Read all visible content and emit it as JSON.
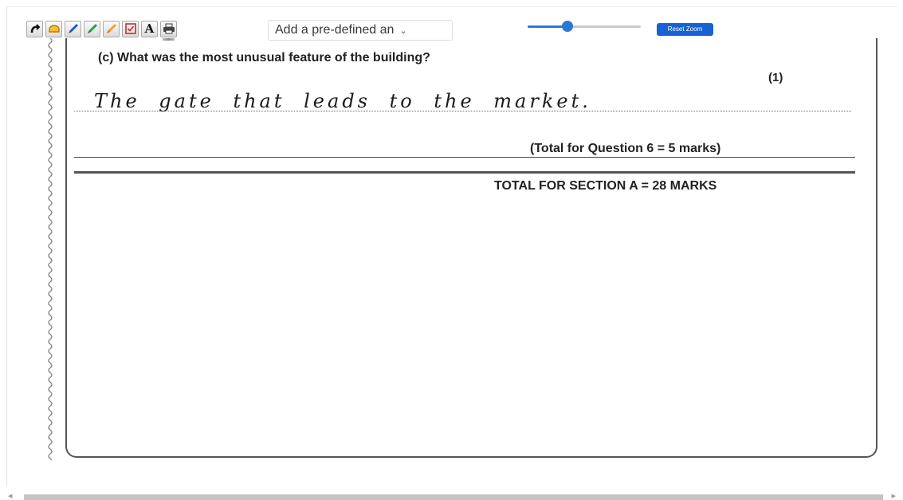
{
  "toolbar": {
    "tools": [
      {
        "name": "undo",
        "icon": "undo-arrow-icon"
      },
      {
        "name": "eraser",
        "icon": "eraser-icon"
      },
      {
        "name": "blue-pen",
        "icon": "blue-pen-icon",
        "color": "#1e57c9"
      },
      {
        "name": "green-pen",
        "icon": "green-pen-icon",
        "color": "#1aa33a"
      },
      {
        "name": "highlighter",
        "icon": "highlighter-icon",
        "color": "#f0a030"
      },
      {
        "name": "checkbox",
        "icon": "checkbox-tick-icon",
        "color": "#d02a2a"
      },
      {
        "name": "text",
        "icon": "text-tool-icon",
        "label": "A"
      },
      {
        "name": "print",
        "icon": "printer-icon"
      }
    ],
    "predefined_select": {
      "value": "Add a pre-defined an",
      "chevron": "chevron-down-icon"
    },
    "zoom_slider": {
      "value_percent": 35,
      "color": "#2e77d0"
    },
    "reset_zoom_label": "Reset Zoom",
    "reset_zoom_color": "#1662d2"
  },
  "document": {
    "question": "(c) What was the most unusual feature of the building?",
    "question_marks": "(1)",
    "handwritten_answer": "The gate that leads to the market.",
    "total_question": "(Total for Question 6 = 5 marks)",
    "total_section": "TOTAL FOR SECTION A = 28 MARKS"
  }
}
